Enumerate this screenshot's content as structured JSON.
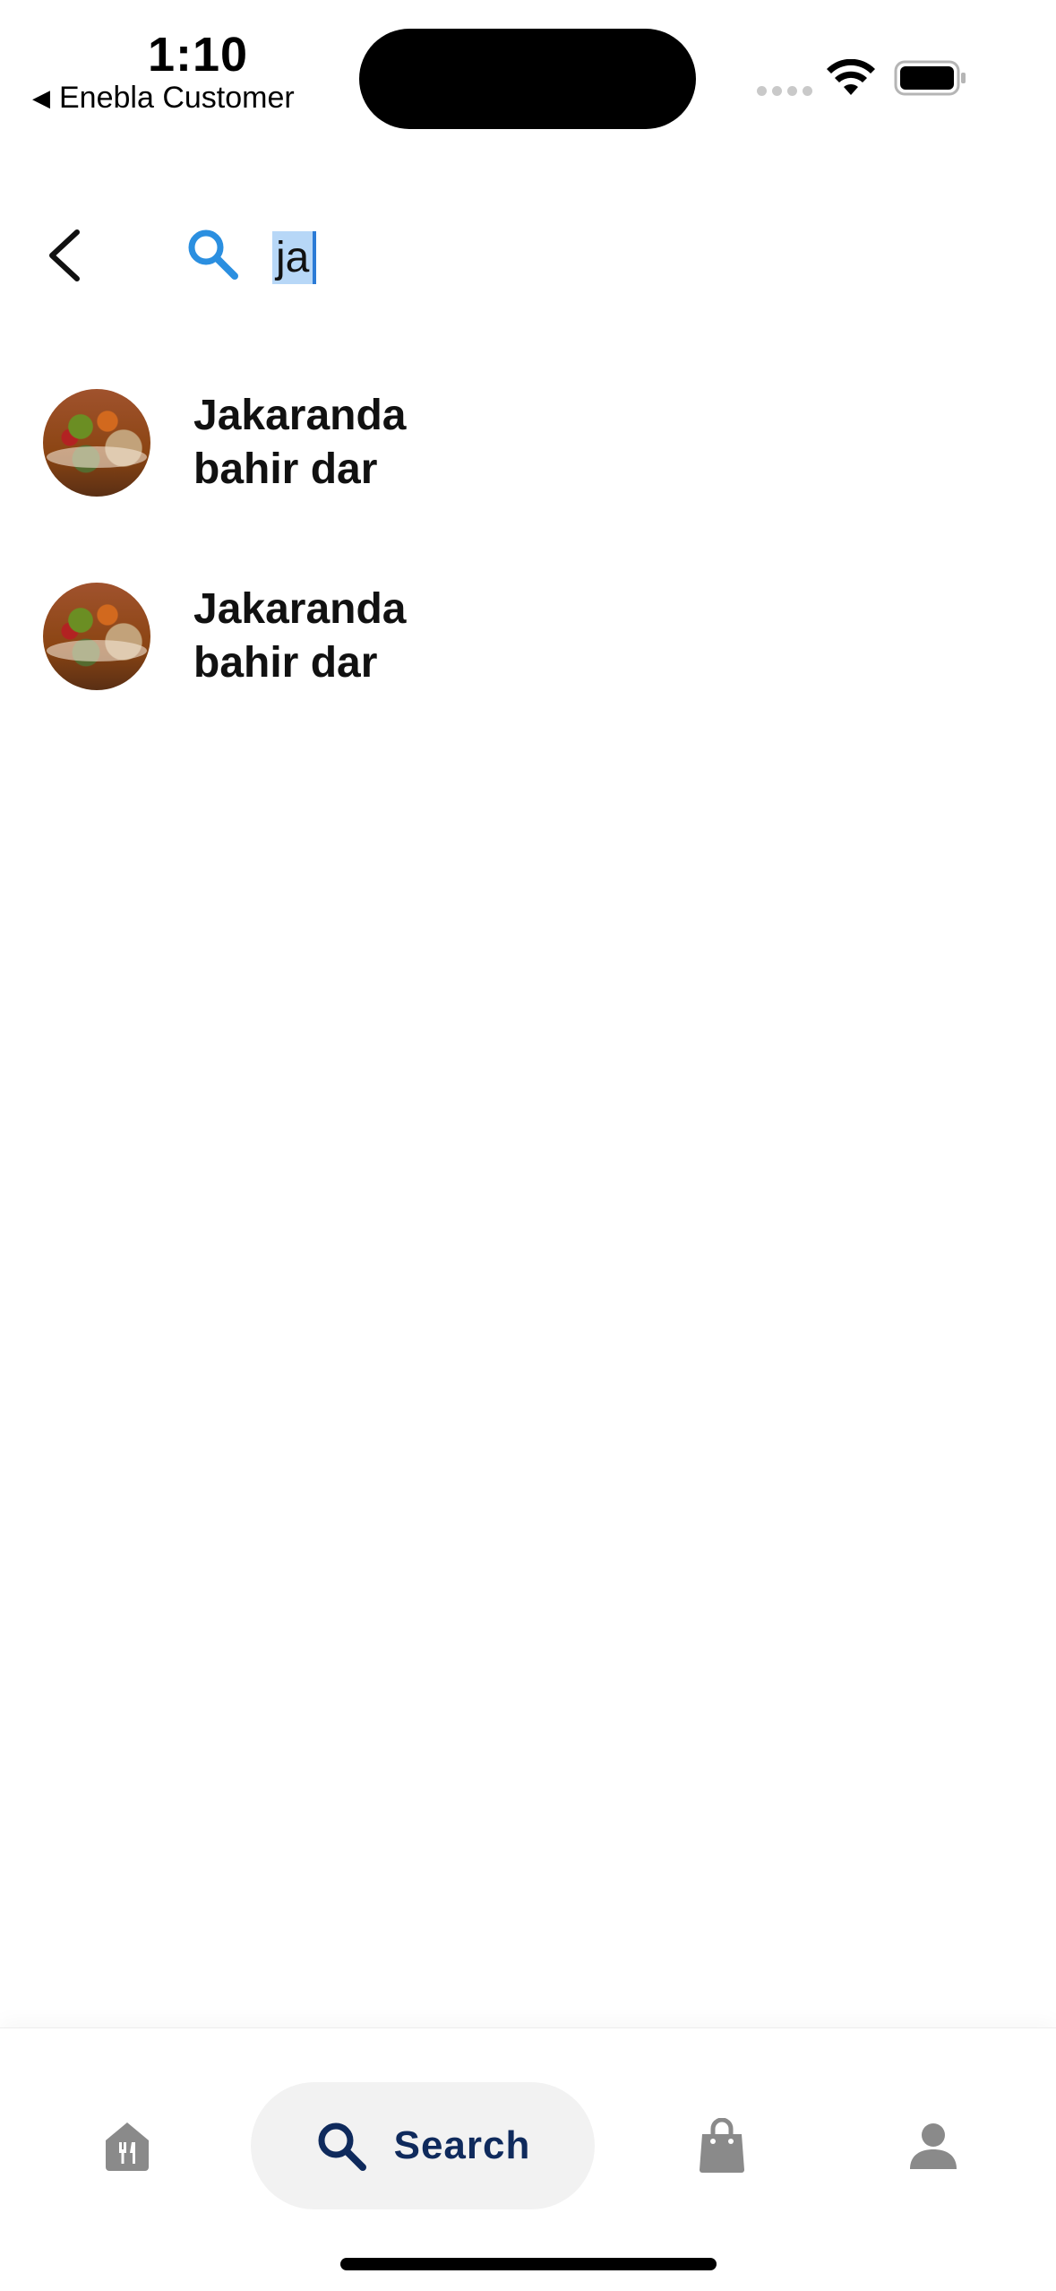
{
  "status_bar": {
    "time": "1:10",
    "back_app_label": "Enebla Customer"
  },
  "search": {
    "query": "ja",
    "icon": "search-icon",
    "accent_color": "#2b8fe0"
  },
  "results": [
    {
      "name_line1": "Jakaranda",
      "name_line2": "bahir dar"
    },
    {
      "name_line1": "Jakaranda",
      "name_line2": "bahir dar"
    }
  ],
  "bottom_nav": {
    "items": [
      {
        "icon": "restaurant-icon",
        "label": ""
      },
      {
        "icon": "search-icon",
        "label": "Search",
        "active": true
      },
      {
        "icon": "shopping-bag-icon",
        "label": ""
      },
      {
        "icon": "person-icon",
        "label": ""
      }
    ],
    "active_color": "#0f2a5c",
    "inactive_color": "#8a8a8a"
  }
}
